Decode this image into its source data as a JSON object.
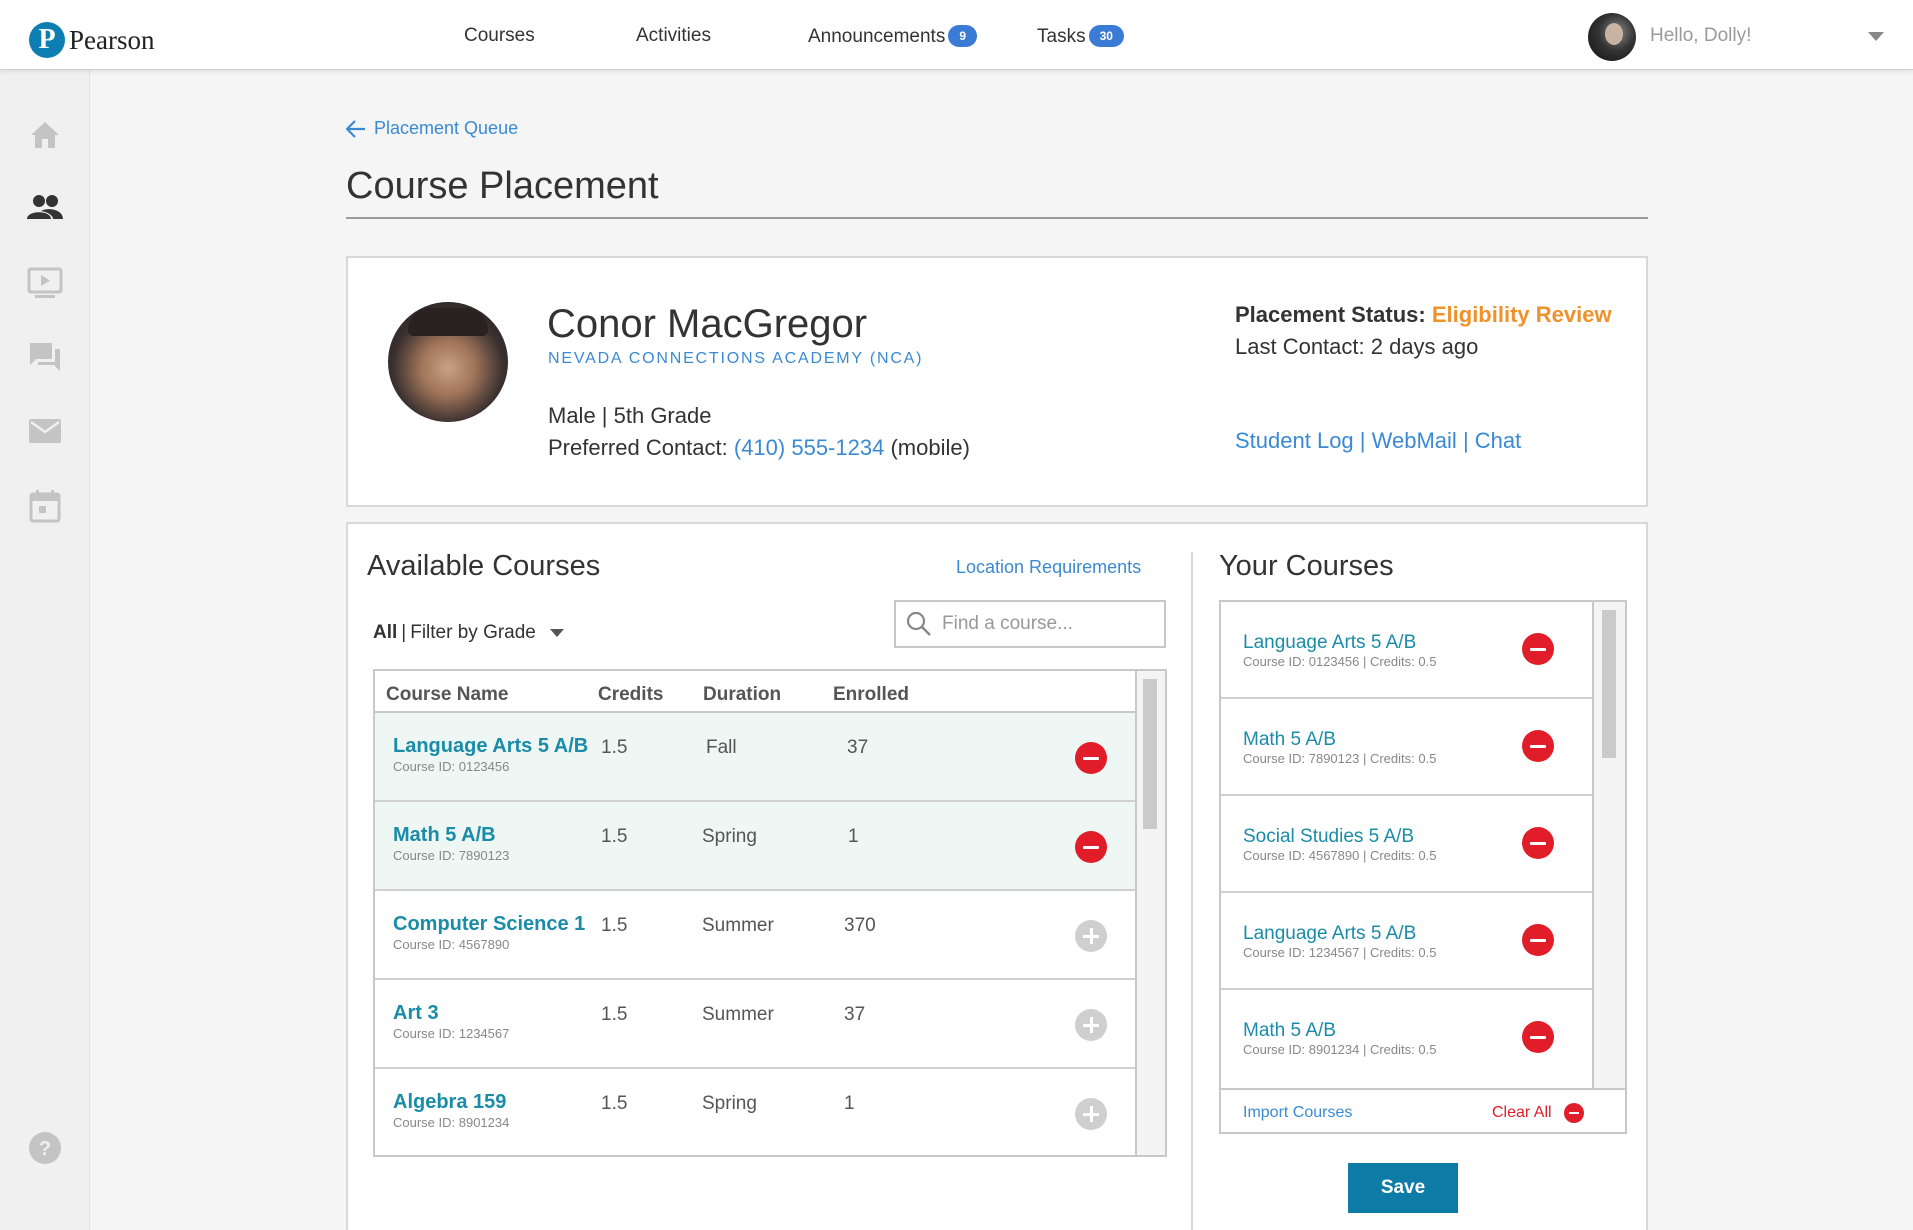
{
  "brand": {
    "logo_letter": "P",
    "name": "Pearson",
    "color": "#0c7eb1"
  },
  "nav": {
    "courses": "Courses",
    "activities": "Activities",
    "announcements": "Announcements",
    "announcements_count": "9",
    "tasks": "Tasks",
    "tasks_count": "30"
  },
  "user": {
    "greeting": "Hello, Dolly!"
  },
  "sidebar": {
    "icons": [
      "home-icon",
      "people-icon",
      "video-icon",
      "chat-icon",
      "mail-icon",
      "calendar-icon",
      "help-icon"
    ]
  },
  "breadcrumb": {
    "back_label": "Placement Queue"
  },
  "page": {
    "title": "Course Placement"
  },
  "student": {
    "name": "Conor MacGregor",
    "school": "NEVADA CONNECTIONS ACADEMY (NCA)",
    "demographics": "Male | 5th Grade",
    "contact_label": "Preferred Contact:",
    "phone": "(410) 555-1234",
    "phone_type": "(mobile)",
    "status_label": "Placement Status:",
    "status_value": "Eligibility Review",
    "last_contact": "Last Contact: 2 days ago",
    "link_log": "Student Log",
    "link_webmail": "WebMail",
    "link_chat": "Chat",
    "link_separator": "|"
  },
  "available": {
    "title": "Available Courses",
    "location_link": "Location Requirements",
    "filter_all": "All",
    "filter_separator": "|",
    "filter_label": "Filter by Grade",
    "search_placeholder": "Find a course...",
    "columns": {
      "name": "Course Name",
      "credits": "Credits",
      "duration": "Duration",
      "enrolled": "Enrolled"
    },
    "rows": [
      {
        "name": "Language Arts 5 A/B",
        "id": "Course ID: 0123456",
        "credits": "1.5",
        "duration": "Fall",
        "enrolled": "37",
        "selected": true
      },
      {
        "name": "Math 5 A/B",
        "id": "Course ID: 7890123",
        "credits": "1.5",
        "duration": "Spring",
        "enrolled": "1",
        "selected": true
      },
      {
        "name": "Computer Science 1",
        "id": "Course ID: 4567890",
        "credits": "1.5",
        "duration": "Summer",
        "enrolled": "370",
        "selected": false
      },
      {
        "name": "Art 3",
        "id": "Course ID: 1234567",
        "credits": "1.5",
        "duration": "Summer",
        "enrolled": "37",
        "selected": false
      },
      {
        "name": "Algebra 159",
        "id": "Course ID: 8901234",
        "credits": "1.5",
        "duration": "Spring",
        "enrolled": "1",
        "selected": false
      }
    ]
  },
  "yours": {
    "title": "Your Courses",
    "items": [
      {
        "name": "Language Arts 5 A/B",
        "meta": "Course ID: 0123456 | Credits: 0.5"
      },
      {
        "name": "Math 5 A/B",
        "meta": "Course ID: 7890123 | Credits: 0.5"
      },
      {
        "name": "Social Studies 5 A/B",
        "meta": "Course ID: 4567890 | Credits: 0.5"
      },
      {
        "name": "Language Arts 5 A/B",
        "meta": "Course ID: 1234567 | Credits: 0.5"
      },
      {
        "name": "Math 5 A/B",
        "meta": "Course ID: 8901234 | Credits: 0.5"
      }
    ],
    "import_label": "Import Courses",
    "clear_label": "Clear All",
    "save_label": "Save"
  },
  "colors": {
    "accent": "#3a8ad3",
    "link_teal": "#1a8ca8",
    "status_orange": "#f0922b",
    "remove_red": "#e11d2a",
    "save_blue": "#0e7ca6"
  }
}
